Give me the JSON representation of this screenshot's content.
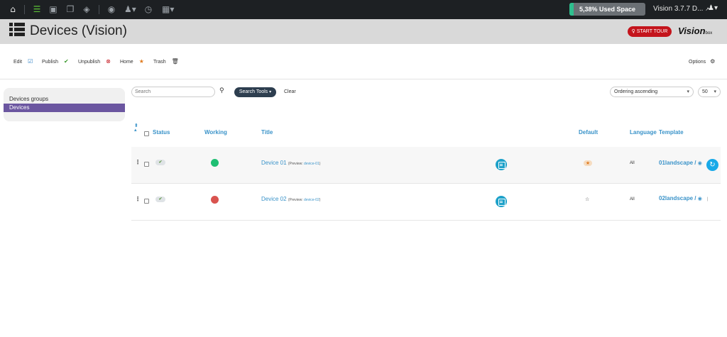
{
  "topbar": {
    "icons": [
      "home-icon",
      "list-icon",
      "image-icon",
      "copy-icon",
      "cube-icon",
      "eye-icon",
      "users-icon",
      "clock-icon",
      "grid-icon"
    ],
    "used_space_label": "5,38% Used Space",
    "used_space_fraction": 0.0538,
    "version_label": "Vision 3.7.7 D...",
    "user_icon": "user-icon"
  },
  "header": {
    "title": "Devices (Vision)",
    "start_tour_label": "START TOUR",
    "brand_main": "Vision",
    "brand_sub": "box"
  },
  "toolbar": {
    "edit_label": "Edit",
    "publish_label": "Publish",
    "unpublish_label": "Unpublish",
    "home_label": "Home",
    "trash_label": "Trash",
    "options_label": "Options"
  },
  "sidebar": {
    "items": [
      {
        "label": "Devices groups",
        "active": false
      },
      {
        "label": "Devices",
        "active": true
      }
    ]
  },
  "filters": {
    "search_placeholder": "Search",
    "search_tools_label": "Search Tools",
    "clear_label": "Clear",
    "ordering_value": "Ordering ascending",
    "limit_value": "50"
  },
  "table": {
    "headers": {
      "status": "Status",
      "working": "Working",
      "title": "Title",
      "default": "Default",
      "language": "Language",
      "template": "Template"
    },
    "rows": [
      {
        "title": "Device 01",
        "preview_prefix": "(Preview:",
        "preview_link": "device-01",
        "preview_suffix": ")",
        "working_color": "#1fbf73",
        "default": true,
        "language": "All",
        "template": "01landscape /"
      },
      {
        "title": "Device 02",
        "preview_prefix": "(Preview:",
        "preview_link": "device-02",
        "preview_suffix": ")",
        "working_color": "#d9534f",
        "default": false,
        "language": "All",
        "template": "02landscape /"
      }
    ]
  }
}
